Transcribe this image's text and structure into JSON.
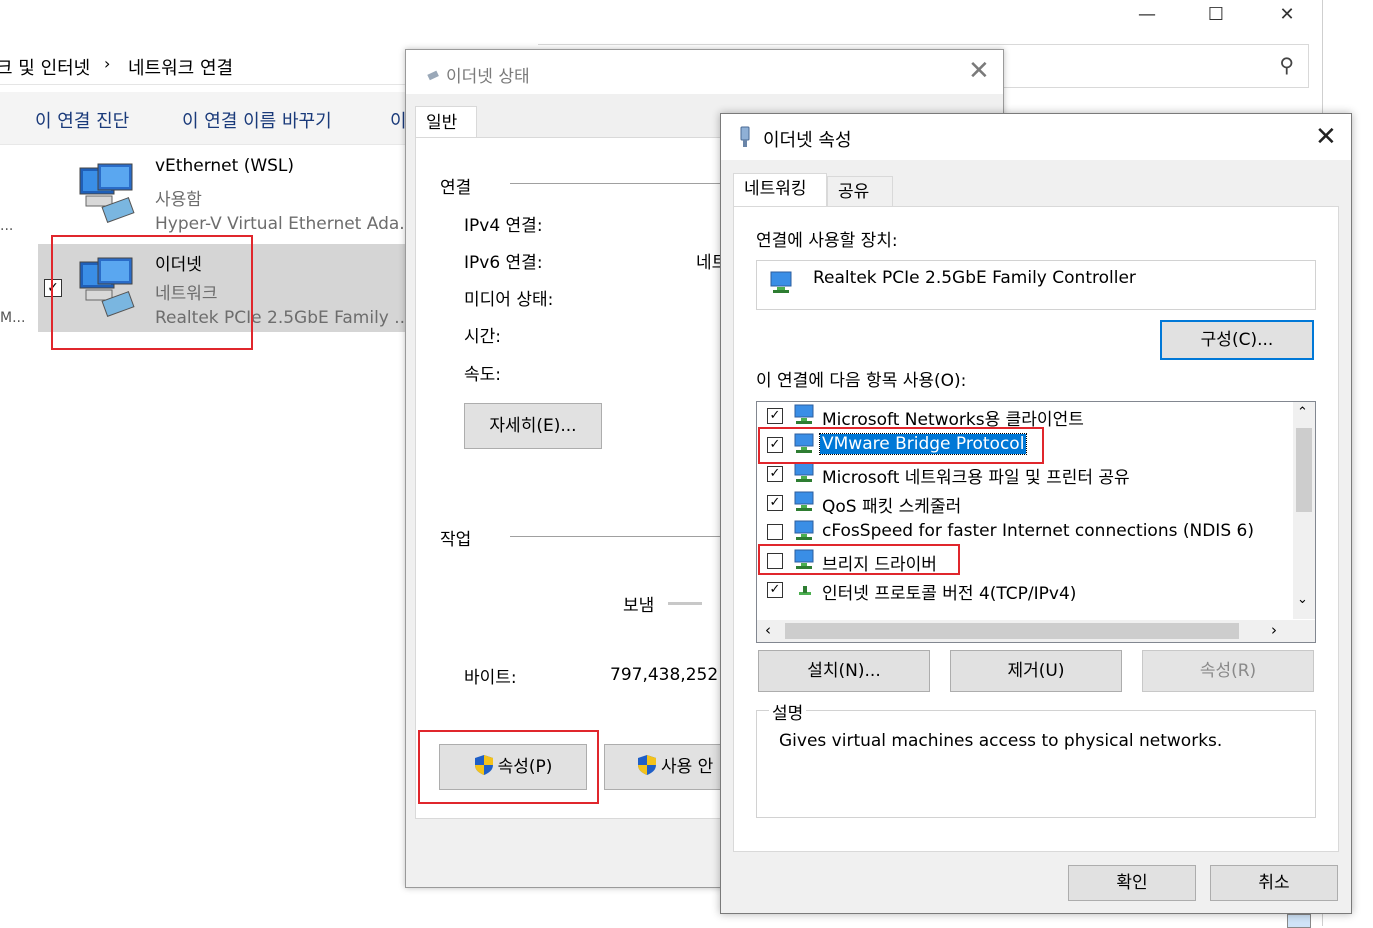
{
  "explorer": {
    "breadcrumb": [
      "크 및 인터넷",
      "›",
      "네트워크 연결"
    ],
    "commands": [
      "이 연결 진단",
      "이 연결 이름 바꾸기",
      "이"
    ],
    "left_trunc_1": "...",
    "left_trunc_2": "M...",
    "items": [
      {
        "title": "vEthernet (WSL)",
        "status": "사용함",
        "device": "Hyper-V Virtual Ethernet Ada..."
      },
      {
        "title": "이더넷",
        "status": "네트워크",
        "device": "Realtek PCIe 2.5GbE Family ..."
      }
    ],
    "window_controls": {
      "minimize": "—",
      "maximize": "☐",
      "close": "✕"
    },
    "search_icon": "⚲"
  },
  "status_dialog": {
    "title": "이더넷 상태",
    "tab": "일반",
    "section_connection": "연결",
    "labels": [
      "IPv4 연결:",
      "IPv6 연결:",
      "미디어 상태:",
      "시간:",
      "속도:"
    ],
    "ipv6_value_partial": "네트",
    "details_button": "자세히(E)...",
    "section_activity": "작업",
    "sent_label": "보냄",
    "bytes_label": "바이트:",
    "bytes_value": "797,438,252",
    "properties_button": "속성(P)",
    "disable_button": "사용 안"
  },
  "properties_dialog": {
    "title": "이더넷 속성",
    "tabs": [
      "네트워킹",
      "공유"
    ],
    "connect_using_label": "연결에 사용할 장치:",
    "device_name": "Realtek PCIe 2.5GbE Family Controller",
    "configure_button": "구성(C)...",
    "items_label": "이 연결에 다음 항목 사용(O):",
    "components": [
      {
        "name": "Microsoft Networks용 클라이언트",
        "checked": true,
        "selected": false
      },
      {
        "name": "VMware Bridge Protocol",
        "checked": true,
        "selected": true
      },
      {
        "name": "Microsoft 네트워크용 파일 및 프린터 공유",
        "checked": true,
        "selected": false
      },
      {
        "name": "QoS 패킷 스케줄러",
        "checked": true,
        "selected": false
      },
      {
        "name": "cFosSpeed for faster Internet connections (NDIS 6)",
        "checked": false,
        "selected": false
      },
      {
        "name": "브리지 드라이버",
        "checked": false,
        "selected": false
      },
      {
        "name": "인터넷 프로토콜 버전 4(TCP/IPv4)",
        "checked": true,
        "selected": false
      }
    ],
    "install_button": "설치(N)...",
    "uninstall_button": "제거(U)",
    "properties_button": "속성(R)",
    "description_label": "설명",
    "description_text": "Gives virtual machines access to physical networks.",
    "ok_button": "확인",
    "cancel_button": "취소",
    "colors": {
      "selection": "#0078d7",
      "highlight_box": "#e0262c"
    }
  }
}
